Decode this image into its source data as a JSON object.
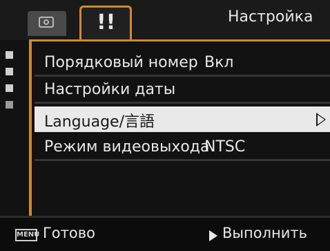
{
  "header": {
    "title": "Настройка",
    "tabs": [
      {
        "name": "shooting",
        "icon": "camera-icon"
      },
      {
        "name": "setup",
        "icon": "setup-tools-icon",
        "glyph": "!!"
      }
    ]
  },
  "menu": {
    "items": [
      {
        "label": "Порядковый номер",
        "value": "Вкл"
      },
      {
        "label": "Настройки даты",
        "value": ""
      },
      {
        "label": "Language/言語",
        "value": ""
      },
      {
        "label": "Режим видеовыхода",
        "value": "NTSC"
      }
    ],
    "selected_index": 2
  },
  "pager": {
    "pages": 4,
    "active": 3
  },
  "footer": {
    "menu_badge": "MENU",
    "done_label": "Готово",
    "execute_label": "Выполнить"
  },
  "colors": {
    "accent": "#d08a2e",
    "selected_bg": "#e9e9e9"
  }
}
